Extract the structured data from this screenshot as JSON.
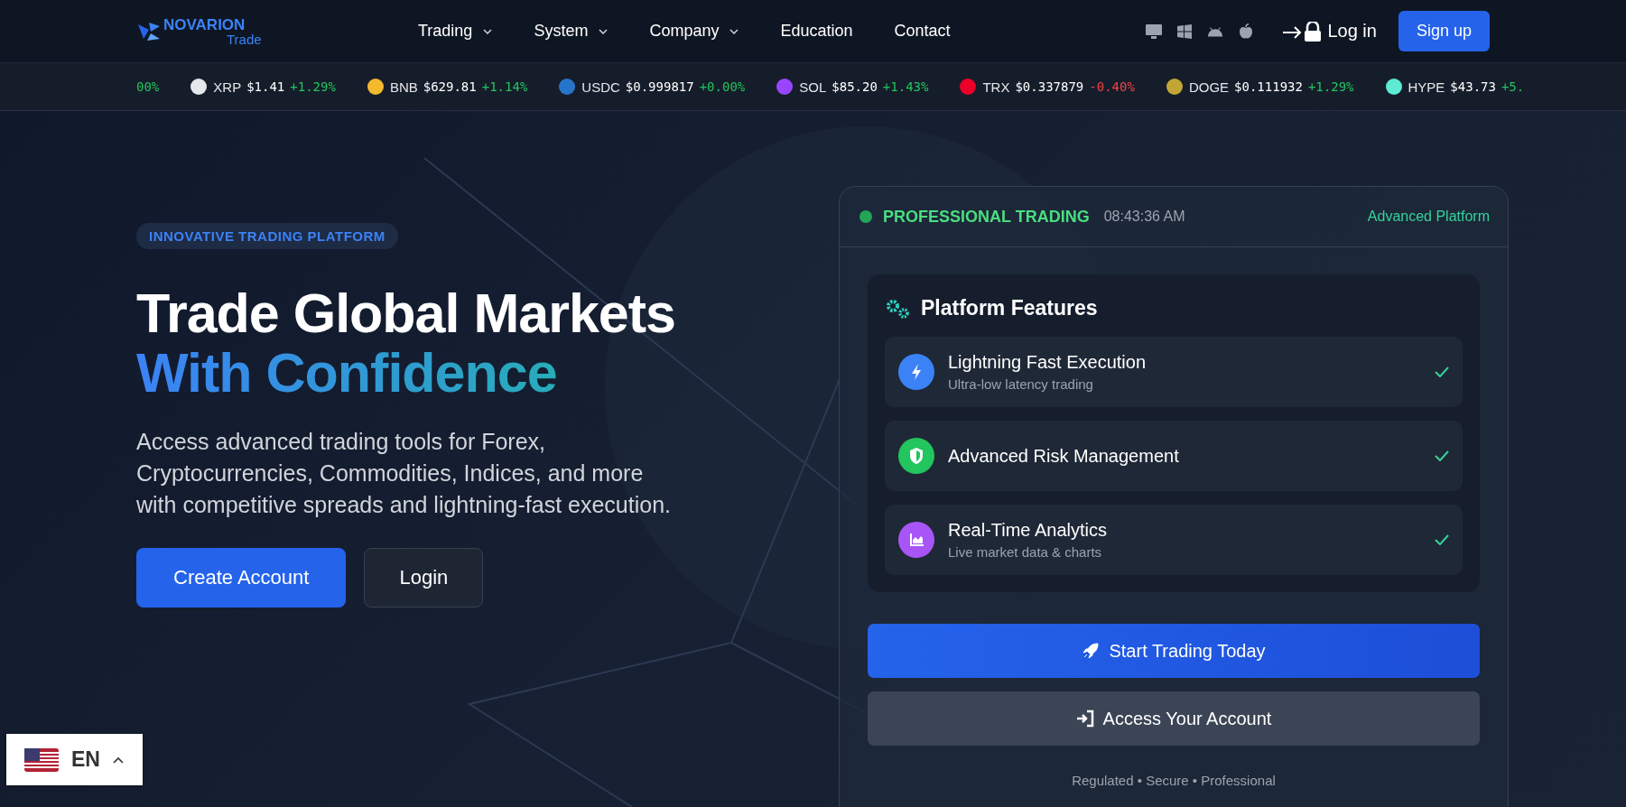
{
  "header": {
    "logo": {
      "name": "NOVARION",
      "sub": "Trade"
    },
    "nav": [
      {
        "label": "Trading",
        "dropdown": true
      },
      {
        "label": "System",
        "dropdown": true
      },
      {
        "label": "Company",
        "dropdown": true
      },
      {
        "label": "Education",
        "dropdown": false
      },
      {
        "label": "Contact",
        "dropdown": false
      }
    ],
    "platforms": [
      {
        "kind": "desktop"
      },
      {
        "kind": "windows"
      },
      {
        "kind": "android"
      },
      {
        "kind": "apple"
      }
    ],
    "login": "Log in",
    "signup": "Sign up"
  },
  "ticker": [
    {
      "change": "00%",
      "negative": false
    },
    {
      "symbol": "XRP",
      "price": "$1.41",
      "change": "+1.29%",
      "negative": false,
      "color": "#e5e7eb"
    },
    {
      "symbol": "BNB",
      "price": "$629.81",
      "change": "+1.14%",
      "negative": false,
      "color": "#f3ba2f"
    },
    {
      "symbol": "USDC",
      "price": "$0.999817",
      "change": "+0.00%",
      "negative": false,
      "color": "#2775ca"
    },
    {
      "symbol": "SOL",
      "price": "$85.20",
      "change": "+1.43%",
      "negative": false,
      "color": "#9945ff"
    },
    {
      "symbol": "TRX",
      "price": "$0.337879",
      "change": "-0.40%",
      "negative": true,
      "color": "#eb0029"
    },
    {
      "symbol": "DOGE",
      "price": "$0.111932",
      "change": "+1.29%",
      "negative": false,
      "color": "#c2a633"
    },
    {
      "symbol": "HYPE",
      "price": "$43.73",
      "change": "+5.",
      "negative": false,
      "color": "#5eead4"
    }
  ],
  "hero": {
    "badge": "INNOVATIVE TRADING PLATFORM",
    "title_line1": "Trade Global Markets",
    "title_line2": "With Confidence",
    "description": "Access advanced trading tools for Forex, Cryptocurrencies, Commodities, Indices, and more with competitive spreads and lightning-fast execution.",
    "buttons": [
      {
        "label": "Create Account",
        "kind": "primary"
      },
      {
        "label": "Login",
        "kind": "secondary"
      }
    ]
  },
  "card": {
    "status": "PROFESSIONAL TRADING",
    "time": "08:43:36 AM",
    "tag": "Advanced Platform",
    "features_title": "Platform Features",
    "features": [
      {
        "kind": "bolt",
        "color": "#3b82f6",
        "title": "Lightning Fast Execution",
        "subtitle": "Ultra-low latency trading",
        "checked": true
      },
      {
        "kind": "shield",
        "color": "#22c55e",
        "title": "Advanced Risk Management",
        "checked": true
      },
      {
        "kind": "chart",
        "color": "#a855f7",
        "title": "Real-Time Analytics",
        "subtitle": "Live market data & charts",
        "checked": true
      }
    ],
    "buttons": [
      {
        "label": "Start Trading Today",
        "kind": "primary"
      },
      {
        "label": "Access Your Account",
        "kind": "secondary"
      }
    ],
    "footer": "Regulated • Secure • Professional"
  },
  "language": {
    "code": "EN"
  }
}
